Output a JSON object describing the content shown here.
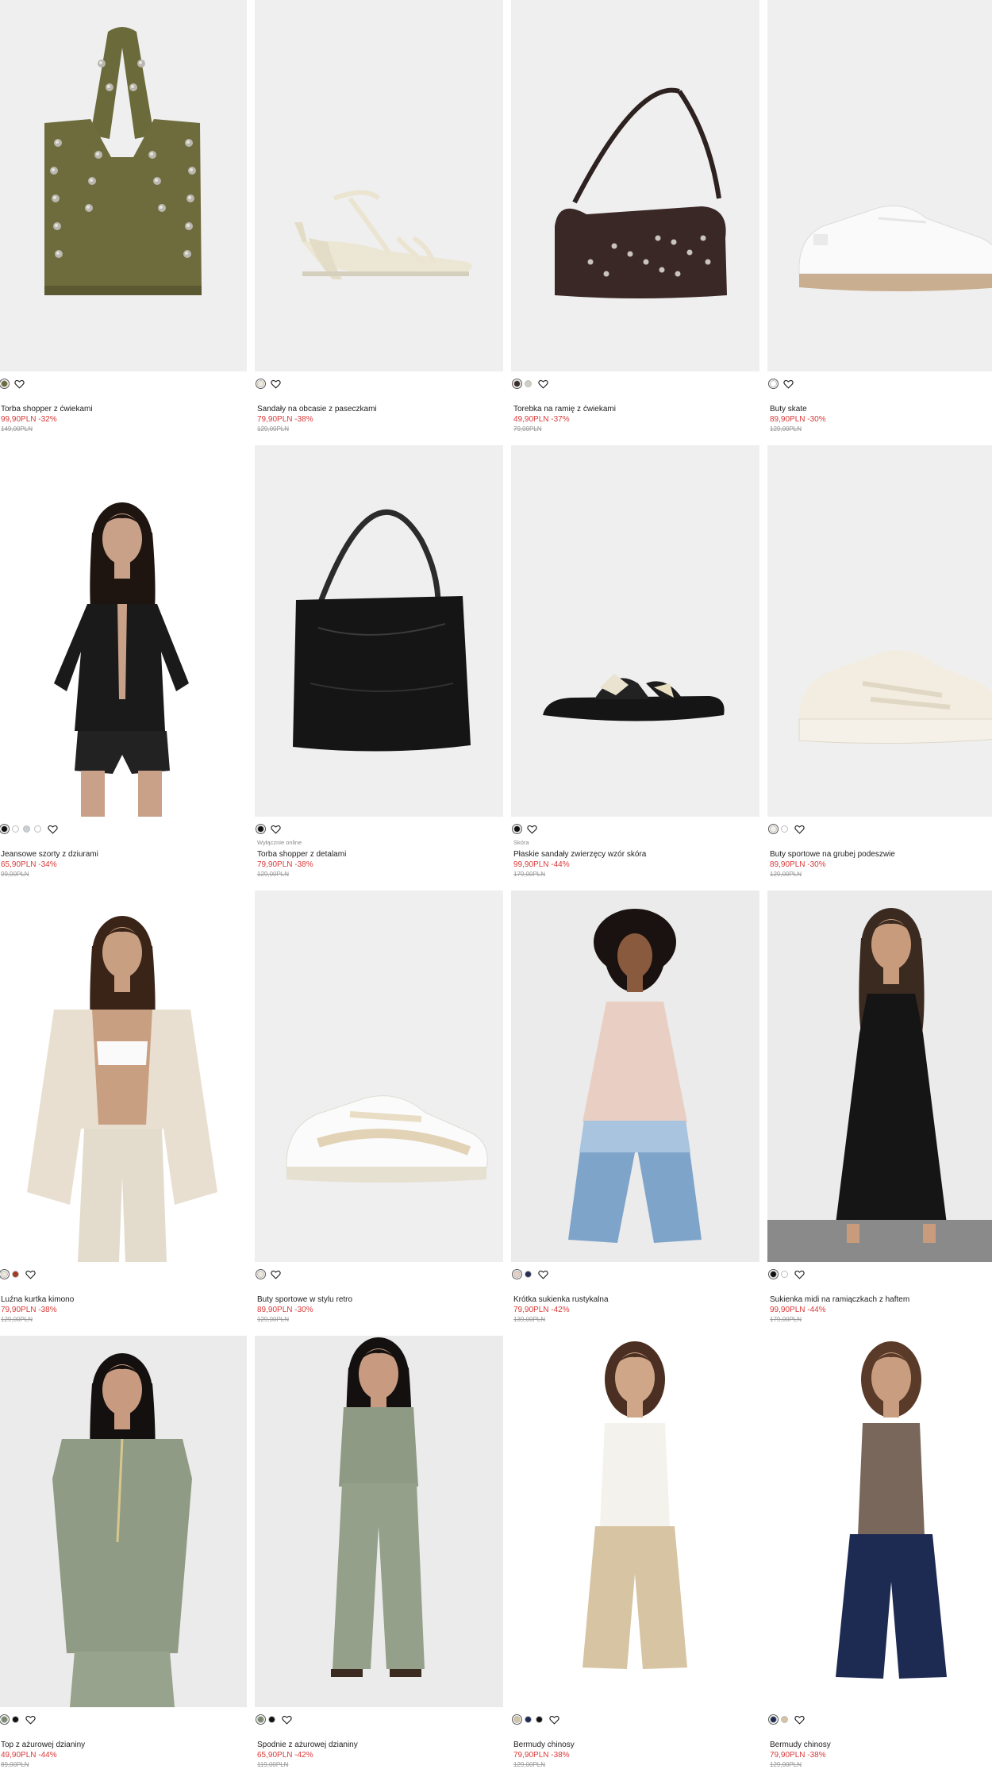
{
  "products": [
    {
      "name": "Torba shopper z ćwiekami",
      "price": "99,90PLN -32%",
      "old_price": "149,00PLN",
      "tag": "",
      "colors": [
        "#6b6a3a"
      ],
      "image": "olive-studded-shopper-bag"
    },
    {
      "name": "Sandały na obcasie z paseczkami",
      "price": "79,90PLN -38%",
      "old_price": "129,00PLN",
      "tag": "",
      "colors": [
        "#efe9d8"
      ],
      "image": "cream-strappy-heeled-sandal"
    },
    {
      "name": "Torebka na ramię z ćwiekami",
      "price": "49,90PLN -37%",
      "old_price": "79,00PLN",
      "tag": "",
      "colors": [
        "#3a2a28",
        "#cfcfc4"
      ],
      "image": "brown-studded-shoulder-bag"
    },
    {
      "name": "Buty skate",
      "price": "89,90PLN -30%",
      "old_price": "129,00PLN",
      "tag": "",
      "colors": [
        "#ffffff"
      ],
      "image": "white-skate-shoe"
    },
    {
      "name": "Jeansowe szorty z dziurami",
      "price": "65,90PLN -34%",
      "old_price": "99,00PLN",
      "tag": "",
      "colors": [
        "#111111",
        "#ffffff",
        "#c8d0d6",
        "#ffffff"
      ],
      "image": "model-black-blouse-shorts"
    },
    {
      "name": "Torba shopper z detalami",
      "price": "79,90PLN -38%",
      "old_price": "129,00PLN",
      "tag": "Wyłącznie online",
      "colors": [
        "#111111"
      ],
      "image": "black-leather-shopper"
    },
    {
      "name": "Płaskie sandały zwierzęcy wzór skóra",
      "price": "99,90PLN -44%",
      "old_price": "179,00PLN",
      "tag": "Skóra",
      "colors": [
        "#111111"
      ],
      "image": "black-animal-print-slide-sandal"
    },
    {
      "name": "Buty sportowe na grubej podeszwie",
      "price": "89,90PLN -30%",
      "old_price": "129,00PLN",
      "tag": "",
      "colors": [
        "#f2efe6",
        "#ffffff"
      ],
      "image": "cream-chunky-sneaker"
    },
    {
      "name": "Luźna kurtka kimono",
      "price": "79,90PLN -38%",
      "old_price": "129,00PLN",
      "tag": "",
      "colors": [
        "#ece6da",
        "#a33a22"
      ],
      "image": "model-linen-kimono"
    },
    {
      "name": "Buty sportowe w stylu retro",
      "price": "89,90PLN -30%",
      "old_price": "129,00PLN",
      "tag": "",
      "colors": [
        "#ece7da"
      ],
      "image": "retro-beige-sneaker"
    },
    {
      "name": "Krótka sukienka rustykalna",
      "price": "79,90PLN -42%",
      "old_price": "139,00PLN",
      "tag": "",
      "colors": [
        "#e8cfc4",
        "#2b2f55"
      ],
      "image": "model-pink-short-dress"
    },
    {
      "name": "Sukienka midi na ramiączkach z haftem",
      "price": "99,90PLN -44%",
      "old_price": "179,00PLN",
      "tag": "",
      "colors": [
        "#111111",
        "#ffffff"
      ],
      "image": "model-black-midi-dress"
    },
    {
      "name": "Top z ażurowej dzianiny",
      "price": "49,90PLN -44%",
      "old_price": "89,00PLN",
      "tag": "",
      "colors": [
        "#7a8a70",
        "#111111"
      ],
      "image": "model-sage-knit-top"
    },
    {
      "name": "Spodnie z ażurowej dzianiny",
      "price": "65,90PLN -42%",
      "old_price": "119,00PLN",
      "tag": "",
      "colors": [
        "#7a8a70",
        "#111111"
      ],
      "image": "model-sage-knit-trousers"
    },
    {
      "name": "Bermudy chinosy",
      "price": "79,90PLN -38%",
      "old_price": "129,00PLN",
      "tag": "",
      "colors": [
        "#d6c3a2",
        "#1d2a52",
        "#111111"
      ],
      "image": "model-beige-bermuda"
    },
    {
      "name": "Bermudy chinosy",
      "price": "79,90PLN -38%",
      "old_price": "129,00PLN",
      "tag": "",
      "colors": [
        "#1d2a52",
        "#d6c3a2"
      ],
      "image": "model-navy-bermuda"
    }
  ]
}
